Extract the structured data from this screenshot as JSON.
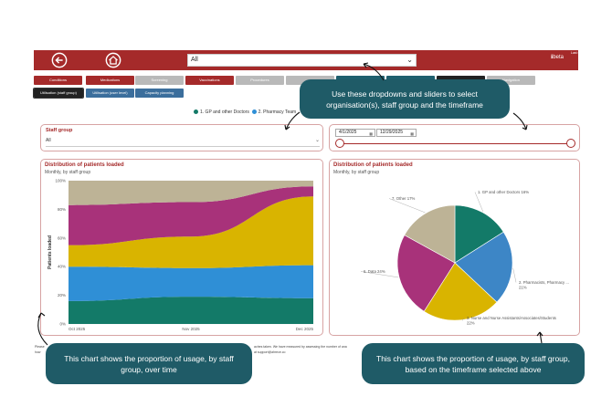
{
  "header": {
    "main_select_value": "All",
    "beta_label": "beta",
    "last_updated_label": "Last updated"
  },
  "tabs_row1": [
    {
      "label": "Conditions",
      "style": "red"
    },
    {
      "label": "Medications",
      "style": "red"
    },
    {
      "label": "Screening",
      "style": "grey"
    },
    {
      "label": "Vaccinations",
      "style": "red"
    },
    {
      "label": "Procedures",
      "style": "grey"
    },
    {
      "label": "",
      "style": "grey"
    },
    {
      "label": "",
      "style": "teal"
    },
    {
      "label": "",
      "style": "teal"
    },
    {
      "label": "",
      "style": "black"
    },
    {
      "label": "Navigation",
      "style": "grey"
    }
  ],
  "tabs_row2": [
    {
      "label": "Utilisation (staff group)",
      "style": "black"
    },
    {
      "label": "Utilisation (user level)",
      "style": "blue"
    },
    {
      "label": "Capacity planning",
      "style": "blue"
    }
  ],
  "legend": {
    "items": [
      "1. GP and other Doctors",
      "2. Pharmacy Team"
    ],
    "colors": [
      "#137a68",
      "#2f8fd6"
    ]
  },
  "staff_group": {
    "title": "Staff group",
    "value": "All"
  },
  "date_range": {
    "start": "4/1/2025",
    "end": "12/29/2025"
  },
  "area_card": {
    "title": "Distribution of patients loaded",
    "subtitle": "Monthly, by staff group"
  },
  "pie_card": {
    "title": "Distribution of patients loaded",
    "subtitle": "Monthly, by staff group"
  },
  "callouts": {
    "top": "Use these dropdowns and sliders to select organisation(s), staff group and the timeframe",
    "left": "This chart shows the proportion of usage, by staff group, over time",
    "right": "This chart shows the proportion of usage, by staff group, based on the timeframe selected above"
  },
  "footnote": {
    "line1_start": "Please",
    "line1_end": "aches taken. We have measured by assessing the number of ana",
    "line2_start": "how",
    "line2_end": "at support@ahrece.co"
  },
  "colors": {
    "brand": "#a52a2a",
    "teal_series": "#137a68",
    "blue_series": "#2f8fd6",
    "yellow_series": "#d9b400",
    "magenta_series": "#a8327a",
    "beige_series": "#bdb396",
    "callout": "#1f5b67"
  },
  "chart_data": [
    {
      "type": "area",
      "title": "Distribution of patients loaded",
      "subtitle": "Monthly, by staff group",
      "xlabel": "",
      "ylabel": "Patients loaded",
      "x": [
        "Oct 2025",
        "Nov 2025",
        "Dec 2025"
      ],
      "y_ticks": [
        "0%",
        "20%",
        "40%",
        "60%",
        "80%",
        "100%"
      ],
      "ylim": [
        0,
        100
      ],
      "stacked_percent": true,
      "series": [
        {
          "name": "1. GP and other Doctors",
          "color": "#137a68",
          "values": [
            16,
            19,
            18
          ]
        },
        {
          "name": "2. Pharmacy Team",
          "color": "#2f8fd6",
          "values": [
            24,
            20,
            23
          ]
        },
        {
          "name": "",
          "color": "#d9b400",
          "values": [
            15,
            22,
            48
          ]
        },
        {
          "name": "",
          "color": "#a8327a",
          "values": [
            28,
            24,
            7
          ]
        },
        {
          "name": "",
          "color": "#bdb396",
          "values": [
            17,
            15,
            4
          ]
        }
      ]
    },
    {
      "type": "pie",
      "title": "Distribution of patients loaded",
      "subtitle": "Monthly, by staff group",
      "slices": [
        {
          "label": "1. GP and other Doctors 16%",
          "value": 16,
          "color": "#137a68"
        },
        {
          "label": "2. Pharmacists, Pharmacy ... 21%",
          "value": 21,
          "color": "#3d86c6"
        },
        {
          "label": "3. Nurse and Nurse Assistants/Associates/Students 22%",
          "value": 22,
          "color": "#d9b400"
        },
        {
          "label": "6. Data 24%",
          "value": 24,
          "color": "#a8327a"
        },
        {
          "label": "7. Other 17%",
          "value": 17,
          "color": "#bdb396"
        }
      ]
    }
  ]
}
